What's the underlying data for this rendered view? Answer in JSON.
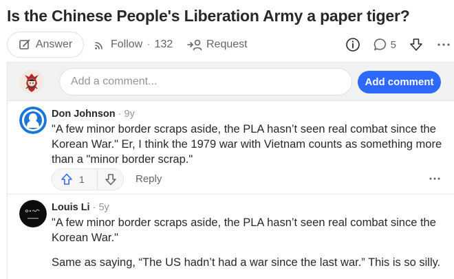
{
  "question": {
    "title": "Is the Chinese People's Liberation Army a paper tiger?"
  },
  "actions": {
    "answer_label": "Answer",
    "follow_label": "Follow",
    "follow_sep": "·",
    "follow_count": "132",
    "request_label": "Request",
    "comment_count": "5"
  },
  "add_comment": {
    "placeholder": "Add a comment...",
    "button_label": "Add comment"
  },
  "comments": [
    {
      "author": "Don Johnson",
      "time": " · 9y",
      "paragraphs": [
        "\"A few minor border scraps aside, the PLA hasn’t seen real combat since the Korean War.\" Er, I think the 1979 war with Vietnam counts as something more than a \"minor border scrap.\""
      ],
      "upvotes": "1",
      "reply_label": "Reply"
    },
    {
      "author": "Louis Li",
      "time": " · 5y",
      "paragraphs": [
        "\"A few minor border scraps aside, the PLA hasn’t seen real combat since the Korean War.\"",
        "Same as saying, “The US hadn’t had a war since the last war.” This is so silly."
      ]
    }
  ],
  "colors": {
    "accent": "#2e69ff",
    "text": "#282829",
    "muted": "#636466",
    "avatar_blue": "#1877d6"
  },
  "icons": [
    "pencil-icon",
    "follow-signal-icon",
    "request-person-icon",
    "info-icon",
    "comment-bubble-icon",
    "downvote-arrow-icon",
    "more-dots-icon",
    "upvote-arrow-icon"
  ]
}
